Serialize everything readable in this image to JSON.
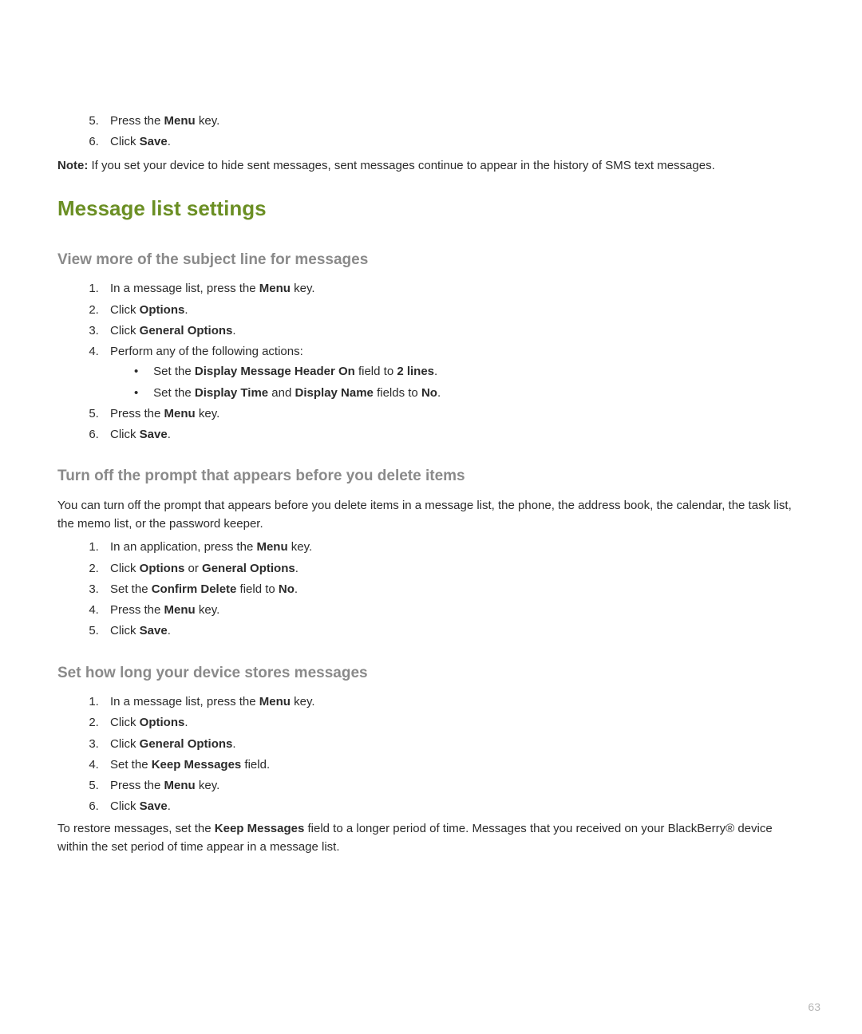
{
  "topList": {
    "item5_pre": "Press the ",
    "item5_bold": "Menu",
    "item5_post": " key.",
    "item6_pre": "Click ",
    "item6_bold": "Save",
    "item6_post": "."
  },
  "note": {
    "label": "Note:",
    "text": "  If you set your device to hide sent messages, sent messages continue to appear in the history of SMS text messages."
  },
  "section_title": "Message list settings",
  "sec1": {
    "title": "View more of the subject line for messages",
    "i1_pre": "In a message list, press the ",
    "i1_bold": "Menu",
    "i1_post": " key.",
    "i2_pre": "Click ",
    "i2_bold": "Options",
    "i2_post": ".",
    "i3_pre": "Click ",
    "i3_bold": "General Options",
    "i3_post": ".",
    "i4": "Perform any of the following actions:",
    "sub1_pre": "Set the ",
    "sub1_b1": "Display Message Header On",
    "sub1_mid": " field to ",
    "sub1_b2": "2 lines",
    "sub1_post": ".",
    "sub2_pre": "Set the ",
    "sub2_b1": "Display Time",
    "sub2_mid1": " and ",
    "sub2_b2": "Display Name",
    "sub2_mid2": " fields to ",
    "sub2_b3": "No",
    "sub2_post": ".",
    "i5_pre": "Press the ",
    "i5_bold": "Menu",
    "i5_post": " key.",
    "i6_pre": "Click ",
    "i6_bold": "Save",
    "i6_post": "."
  },
  "sec2": {
    "title": "Turn off the prompt that appears before you delete items",
    "intro": "You can turn off the prompt that appears before you delete items in a message list, the phone, the address book, the calendar, the task list, the memo list, or the password keeper.",
    "i1_pre": "In an application, press the ",
    "i1_bold": "Menu",
    "i1_post": " key.",
    "i2_pre": "Click ",
    "i2_b1": "Options",
    "i2_mid": " or ",
    "i2_b2": "General Options",
    "i2_post": ".",
    "i3_pre": "Set the ",
    "i3_b1": "Confirm Delete",
    "i3_mid": " field to ",
    "i3_b2": "No",
    "i3_post": ".",
    "i4_pre": "Press the ",
    "i4_bold": "Menu",
    "i4_post": " key.",
    "i5_pre": "Click ",
    "i5_bold": "Save",
    "i5_post": "."
  },
  "sec3": {
    "title": "Set how long your device stores messages",
    "i1_pre": "In a message list, press the ",
    "i1_bold": "Menu",
    "i1_post": " key.",
    "i2_pre": "Click ",
    "i2_bold": "Options",
    "i2_post": ".",
    "i3_pre": "Click ",
    "i3_bold": "General Options",
    "i3_post": ".",
    "i4_pre": "Set the ",
    "i4_bold": "Keep Messages",
    "i4_post": " field.",
    "i5_pre": "Press the ",
    "i5_bold": "Menu",
    "i5_post": " key.",
    "i6_pre": "Click ",
    "i6_bold": "Save",
    "i6_post": ".",
    "outro_pre": "To restore messages, set the ",
    "outro_bold": "Keep Messages",
    "outro_post": " field to a longer period of time. Messages that you received on your BlackBerry® device within the set period of time appear in a message list."
  },
  "page_number": "63"
}
